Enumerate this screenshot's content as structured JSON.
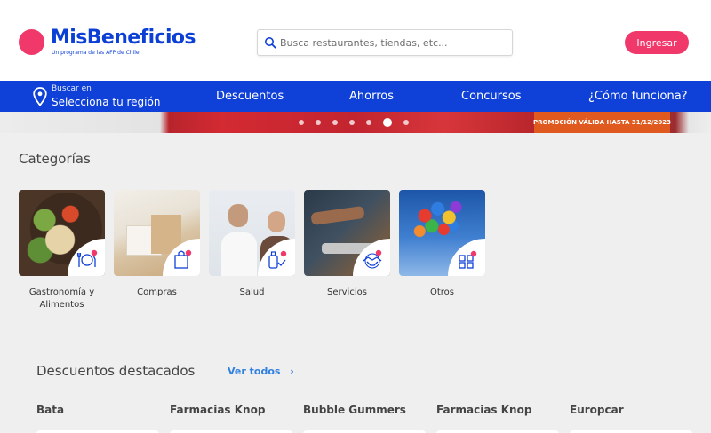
{
  "header": {
    "logo_text": "MisBeneficios",
    "logo_subtitle": "Un programa de las AFP de Chile",
    "search_placeholder": "Busca restaurantes, tiendas, etc...",
    "login_label": "Ingresar"
  },
  "nav": {
    "region_label": "Buscar en",
    "region_value": "Selecciona tu región",
    "links": [
      "Descuentos",
      "Ahorros",
      "Concursos",
      "¿Cómo funciona?"
    ]
  },
  "banner": {
    "promo_text": "PROMOCIÓN VÁLIDA HASTA 31/12/2023",
    "active_slide": 6,
    "slide_count": 7
  },
  "categories": {
    "title": "Categorías",
    "items": [
      {
        "label": "Gastronomía y Alimentos",
        "icon": "utensils-icon"
      },
      {
        "label": "Compras",
        "icon": "shopping-bag-icon"
      },
      {
        "label": "Salud",
        "icon": "health-icon"
      },
      {
        "label": "Servicios",
        "icon": "handshake-icon"
      },
      {
        "label": "Otros",
        "icon": "grid-icon"
      }
    ]
  },
  "featured": {
    "title": "Descuentos destacados",
    "see_all": "Ver todos",
    "brands": [
      "Bata",
      "Farmacias Knop",
      "Bubble Gummers",
      "Farmacias Knop",
      "Europcar"
    ]
  },
  "colors": {
    "brand_blue": "#0f40d8",
    "accent_pink": "#f0386b",
    "promo_orange": "#e05a1f"
  }
}
